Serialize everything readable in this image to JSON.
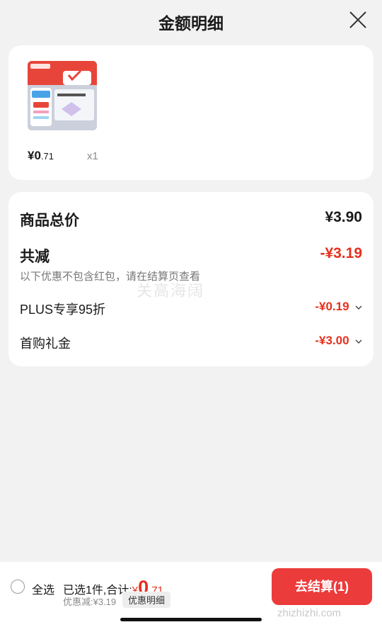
{
  "header": {
    "title": "金额明细"
  },
  "product": {
    "image_alt": "京东京东健康 维生素B族",
    "price_currency": "¥",
    "price_int": "0",
    "price_dec": ".71",
    "quantity": "x1"
  },
  "summary": {
    "total_label": "商品总价",
    "total_value": "¥3.90",
    "reduce_label": "共减",
    "reduce_value": "-¥3.19",
    "note": "以下优惠不包含红包，请在结算页查看",
    "items": [
      {
        "label": "PLUS专享95折",
        "value": "-¥0.19"
      },
      {
        "label": "首购礼金",
        "value": "-¥3.00"
      }
    ]
  },
  "watermark": "关高海阔",
  "bottom": {
    "select_all": "全选",
    "selected_text": "已选1件,合计:",
    "total_currency": "¥",
    "total_int": "0",
    "total_dec": ".71",
    "discount_text": "优惠减:¥3.19",
    "detail_button": "优惠明细",
    "checkout_button": "去结算(1)",
    "site_mark": "zhizhizhi.com"
  },
  "colors": {
    "accent_red": "#e6301e",
    "checkout_red": "#ec3b3b",
    "background": "#f2f2f2"
  }
}
